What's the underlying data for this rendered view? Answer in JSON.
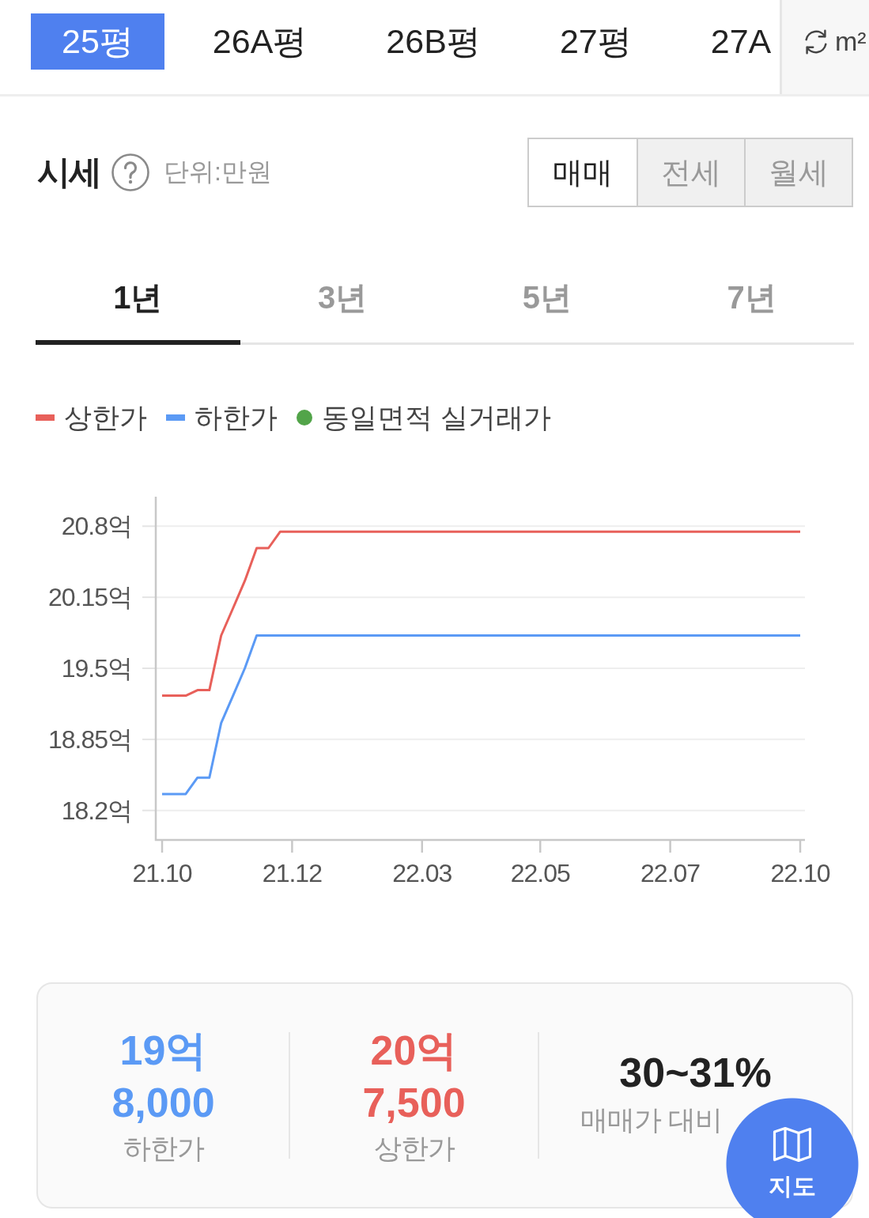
{
  "size_tabs": [
    {
      "label": "25평",
      "selected": true
    },
    {
      "label": "26A평",
      "selected": false
    },
    {
      "label": "26B평",
      "selected": false
    },
    {
      "label": "27평",
      "selected": false
    },
    {
      "label": "27A",
      "selected": false
    }
  ],
  "unit_toggle": {
    "label": "m²"
  },
  "price_section": {
    "title": "시세",
    "unit": "단위:만원",
    "deal_types": [
      {
        "label": "매매",
        "selected": true
      },
      {
        "label": "전세",
        "selected": false
      },
      {
        "label": "월세",
        "selected": false
      }
    ]
  },
  "periods": [
    {
      "label": "1년",
      "selected": true
    },
    {
      "label": "3년",
      "selected": false
    },
    {
      "label": "5년",
      "selected": false
    },
    {
      "label": "7년",
      "selected": false
    }
  ],
  "price_chart": {
    "trade_legend": {
      "label": "동일면적 실거래가",
      "color": "#52a449"
    },
    "chart_data": {
      "type": "line",
      "grid": true,
      "categories": [
        "21.10",
        null,
        null,
        null,
        null,
        null,
        null,
        null,
        null,
        null,
        null,
        "21.12",
        null,
        null,
        null,
        null,
        null,
        null,
        null,
        null,
        null,
        null,
        "22.03",
        null,
        null,
        null,
        null,
        null,
        null,
        null,
        null,
        null,
        "22.05",
        null,
        null,
        null,
        null,
        null,
        null,
        null,
        null,
        null,
        null,
        "22.07",
        null,
        null,
        null,
        null,
        null,
        null,
        null,
        null,
        null,
        null,
        "22.10"
      ],
      "series": [
        {
          "name": "상한가",
          "color": "#e8605a",
          "values": [
            19.25,
            19.25,
            19.25,
            19.3,
            19.3,
            19.8,
            20.05,
            20.3,
            20.6,
            20.6,
            20.75,
            20.75,
            20.75,
            20.75,
            20.75,
            20.75,
            20.75,
            20.75,
            20.75,
            20.75,
            20.75,
            20.75,
            20.75,
            20.75,
            20.75,
            20.75,
            20.75,
            20.75,
            20.75,
            20.75,
            20.75,
            20.75,
            20.75,
            20.75,
            20.75,
            20.75,
            20.75,
            20.75,
            20.75,
            20.75,
            20.75,
            20.75,
            20.75,
            20.75,
            20.75,
            20.75,
            20.75,
            20.75,
            20.75,
            20.75,
            20.75,
            20.75,
            20.75,
            20.75,
            20.75
          ]
        },
        {
          "name": "하한가",
          "color": "#5b9af5",
          "values": [
            18.35,
            18.35,
            18.35,
            18.5,
            18.5,
            19.0,
            19.25,
            19.5,
            19.8,
            19.8,
            19.8,
            19.8,
            19.8,
            19.8,
            19.8,
            19.8,
            19.8,
            19.8,
            19.8,
            19.8,
            19.8,
            19.8,
            19.8,
            19.8,
            19.8,
            19.8,
            19.8,
            19.8,
            19.8,
            19.8,
            19.8,
            19.8,
            19.8,
            19.8,
            19.8,
            19.8,
            19.8,
            19.8,
            19.8,
            19.8,
            19.8,
            19.8,
            19.8,
            19.8,
            19.8,
            19.8,
            19.8,
            19.8,
            19.8,
            19.8,
            19.8,
            19.8,
            19.8,
            19.8,
            19.8
          ]
        }
      ],
      "ylim": [
        17.93,
        21.07
      ],
      "yticks": [
        {
          "value": 18.2,
          "label": "18.2억"
        },
        {
          "value": 18.85,
          "label": "18.85억"
        },
        {
          "value": 19.5,
          "label": "19.5억"
        },
        {
          "value": 20.15,
          "label": "20.15억"
        },
        {
          "value": 20.8,
          "label": "20.8억"
        }
      ]
    }
  },
  "summary": [
    {
      "kind": "price",
      "value_lines": [
        "19억",
        "8,000"
      ],
      "label": "하한가",
      "color": "#5b9af5"
    },
    {
      "kind": "price",
      "value_lines": [
        "20억",
        "7,500"
      ],
      "label": "상한가",
      "color": "#e8605a"
    },
    {
      "kind": "ratio",
      "value_lines": [
        "30~31%"
      ],
      "label": "매매가 대비",
      "color": "#222222"
    }
  ],
  "map_button": {
    "label": "지도"
  }
}
